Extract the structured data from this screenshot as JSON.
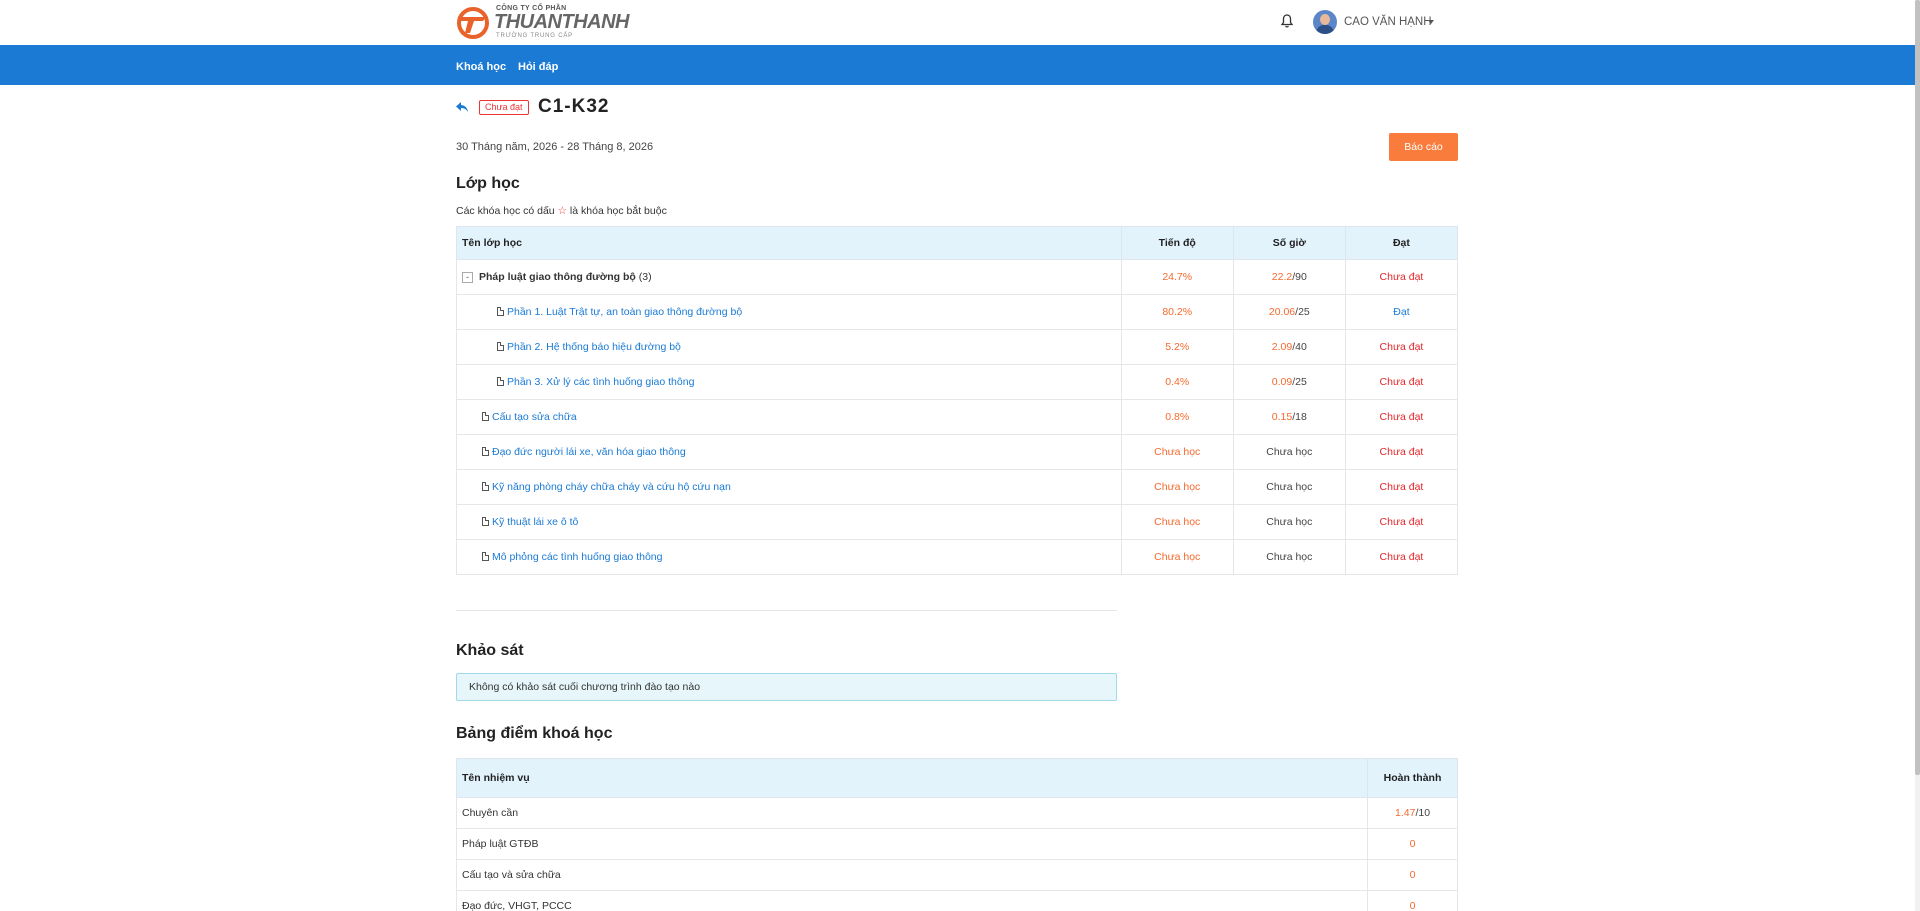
{
  "header": {
    "logo_top": "CÔNG TY CỔ PHẦN",
    "logo_main": "THUANTHANH",
    "logo_sub": "TRƯỜNG TRUNG CẤP",
    "user_name": "CAO VĂN HẠNH"
  },
  "nav": {
    "items": [
      {
        "label": "Khoá học"
      },
      {
        "label": "Hỏi đáp"
      }
    ]
  },
  "course": {
    "status_badge": "Chưa đạt",
    "code": "C1-K32",
    "date_range": "30 Tháng năm, 2026 - 28 Tháng 8, 2026",
    "report_button": "Báo cáo"
  },
  "classes": {
    "title": "Lớp học",
    "note_before": "Các khóa học có dấu",
    "note_star": "☆",
    "note_after": "là khóa học bắt buộc",
    "headers": {
      "name": "Tên lớp học",
      "progress": "Tiến độ",
      "hours": "Số giờ",
      "pass": "Đạt"
    },
    "group": {
      "toggle": "-",
      "name": "Pháp luật giao thông đường bộ",
      "count": "(3)",
      "progress": "24.7%",
      "hours_done": "22.2",
      "hours_total": "/90",
      "pass": "Chưa đạt"
    },
    "sub_rows": [
      {
        "name": "Phần 1. Luật Trật tự, an toàn giao thông đường bộ",
        "progress": "80.2%",
        "hours_done": "20.06",
        "hours_total": "/25",
        "pass": "Đạt"
      },
      {
        "name": "Phần 2. Hệ thống báo hiệu đường bộ",
        "progress": "5.2%",
        "hours_done": "2.09",
        "hours_total": "/40",
        "pass": "Chưa đạt"
      },
      {
        "name": "Phần 3. Xử lý các tình huống giao thông",
        "progress": "0.4%",
        "hours_done": "0.09",
        "hours_total": "/25",
        "pass": "Chưa đạt"
      }
    ],
    "rows": [
      {
        "name": "Cấu tạo sửa chữa",
        "progress": "0.8%",
        "hours_done": "0.15",
        "hours_total": "/18",
        "pass": "Chưa đạt"
      },
      {
        "name": "Đạo đức người lái xe, văn hóa giao thông",
        "progress": "Chưa học",
        "hours": "Chưa học",
        "pass": "Chưa đạt"
      },
      {
        "name": "Kỹ năng phòng cháy chữa cháy và cứu hộ cứu nạn",
        "progress": "Chưa học",
        "hours": "Chưa học",
        "pass": "Chưa đạt"
      },
      {
        "name": "Kỹ thuật lái xe ô tô",
        "progress": "Chưa học",
        "hours": "Chưa học",
        "pass": "Chưa đạt"
      },
      {
        "name": "Mô phỏng các tình huống giao thông",
        "progress": "Chưa học",
        "hours": "Chưa học",
        "pass": "Chưa đạt"
      }
    ]
  },
  "survey": {
    "title": "Khảo sát",
    "message": "Không có khảo sát cuối chương trình đào tạo nào"
  },
  "scores": {
    "title": "Bảng điểm khoá học",
    "headers": {
      "task": "Tên nhiệm vụ",
      "done": "Hoàn thành"
    },
    "rows": [
      {
        "task": "Chuyên cần",
        "score": "1.47",
        "total": "/10"
      },
      {
        "task": "Pháp luật GTĐB",
        "score": "0",
        "total": ""
      },
      {
        "task": "Cấu tạo và sửa chữa",
        "score": "0",
        "total": ""
      },
      {
        "task": "Đạo đức, VHGT, PCCC",
        "score": "0",
        "total": ""
      }
    ]
  },
  "colors": {
    "nav_blue": "#1a7ad4",
    "accent_orange": "#f97c3c",
    "fail_red": "#e3262a",
    "table_header": "#e3f3fc"
  }
}
